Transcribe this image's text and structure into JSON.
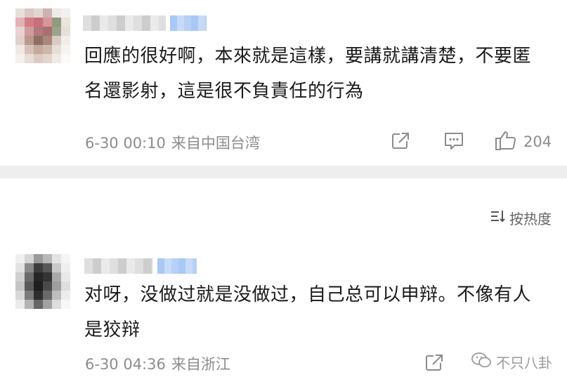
{
  "comments": [
    {
      "text": "回應的很好啊，本來就是這樣，要講就講清楚，不要匿名還影射，這是很不負責任的行為",
      "time": "6-30 00:10",
      "location": "来自中国台湾",
      "likes": "204"
    },
    {
      "text": "对呀，没做过就是没做过，自己总可以申辩。不像有人是狡辩",
      "time": "6-30 04:36",
      "location": "来自浙江"
    }
  ],
  "sort": {
    "label": "按热度"
  },
  "watermark": {
    "text": "不只八卦"
  },
  "icons": {
    "share": "share-icon",
    "comment": "comment-icon",
    "like": "thumbs-up-icon",
    "sort": "sort-icon",
    "wechat": "wechat-icon"
  },
  "colors": {
    "text": "#1a1a1a",
    "meta": "#8c8c8c",
    "divider": "#eeeeee"
  }
}
